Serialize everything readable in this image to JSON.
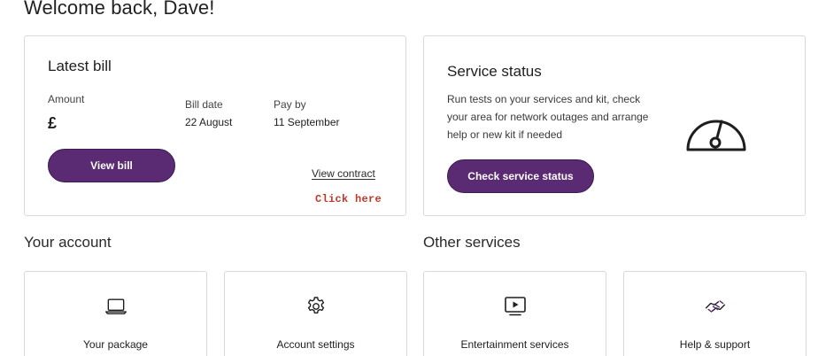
{
  "header": {
    "welcome": "Welcome back, Dave!"
  },
  "latest_bill": {
    "title": "Latest bill",
    "amount_label": "Amount",
    "amount_value": "£",
    "bill_date_label": "Bill date",
    "bill_date_value": "22 August",
    "pay_by_label": "Pay by",
    "pay_by_value": "11 September",
    "view_bill_label": "View bill",
    "view_contract_label": "View contract",
    "click_here_label": "Click here"
  },
  "service_status": {
    "title": "Service status",
    "description": "Run tests on your services and kit, check your area for network outages and arrange help or new kit if needed",
    "button_label": "Check service status",
    "icon": "gauge-icon"
  },
  "your_account": {
    "title": "Your account",
    "tiles": [
      {
        "label": "Your package",
        "icon": "laptop-icon"
      },
      {
        "label": "Account settings",
        "icon": "gear-icon"
      }
    ]
  },
  "other_services": {
    "title": "Other services",
    "tiles": [
      {
        "label": "Entertainment services",
        "icon": "play-screen-icon"
      },
      {
        "label": "Help & support",
        "icon": "handshake-icon"
      }
    ]
  },
  "colors": {
    "accent": "#5a2a72",
    "annotation": "#c0392b"
  }
}
